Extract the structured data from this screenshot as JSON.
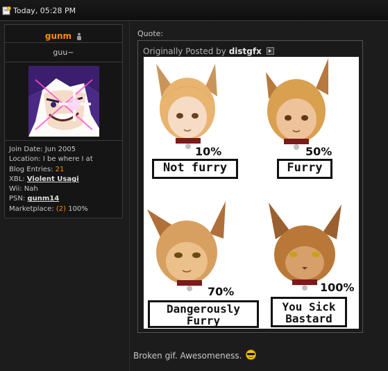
{
  "post": {
    "date": "Today, 05:28 PM"
  },
  "user": {
    "username": "gunm",
    "title": "guu~",
    "stats": {
      "join_label": "Join Date:",
      "join_value": "Jun 2005",
      "location_label": "Location:",
      "location_value": "I be where I at",
      "blog_label": "Blog Entries:",
      "blog_value": "21",
      "xbl_label": "XBL:",
      "xbl_value": "Violent Usagi",
      "wii_label": "Wii:",
      "wii_value": "Nah",
      "psn_label": "PSN:",
      "psn_value": "gunm14",
      "market_label": "Marketplace:",
      "market_count": "(2)",
      "market_pct": "100%"
    }
  },
  "quote": {
    "label": "Quote:",
    "header_prefix": "Originally Posted by",
    "author": "distgfx",
    "image": {
      "panels": [
        {
          "percent": "10%",
          "caption": "Not furry"
        },
        {
          "percent": "50%",
          "caption": "Furry"
        },
        {
          "percent": "70%",
          "caption_line1": "Dangerously",
          "caption_line2": "Furry"
        },
        {
          "percent": "100%",
          "caption_line1": "You Sick",
          "caption_line2": "Bastard"
        }
      ]
    }
  },
  "message": {
    "text": "Broken gif. Awesomeness."
  },
  "colors": {
    "accent": "#ff8c00",
    "background": "#1c1c1c",
    "panel": "#151515"
  }
}
